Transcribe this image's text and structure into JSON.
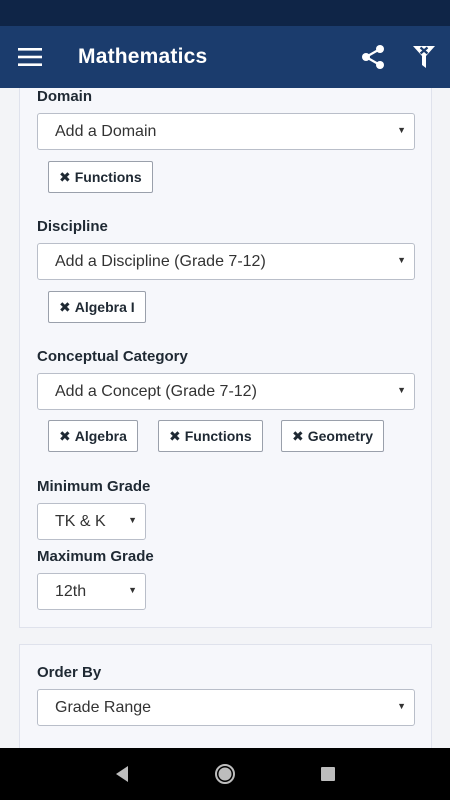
{
  "app_bar": {
    "title": "Mathematics",
    "menu_icon": "hamburger-menu-icon",
    "share_icon": "share-icon",
    "filter_icon": "filter-clear-icon",
    "bg_color": "#1b3c6d",
    "status_color": "#0f2547"
  },
  "filters": {
    "domain": {
      "label": "Domain",
      "select_value": "Add a Domain",
      "chips": [
        "Functions"
      ]
    },
    "discipline": {
      "label": "Discipline",
      "select_value": "Add a Discipline (Grade 7-12)",
      "chips": [
        "Algebra I"
      ]
    },
    "concept": {
      "label": "Conceptual Category",
      "select_value": "Add a Concept (Grade 7-12)",
      "chips": [
        "Algebra",
        "Functions",
        "Geometry"
      ]
    },
    "min_grade": {
      "label": "Minimum Grade",
      "select_value": "TK & K"
    },
    "max_grade": {
      "label": "Maximum Grade",
      "select_value": "12th"
    }
  },
  "order": {
    "label": "Order By",
    "select_value": "Grade Range"
  },
  "nav_bar": {
    "back_icon": "back-triangle-icon",
    "home_icon": "home-circle-icon",
    "recents_icon": "recents-square-icon"
  }
}
